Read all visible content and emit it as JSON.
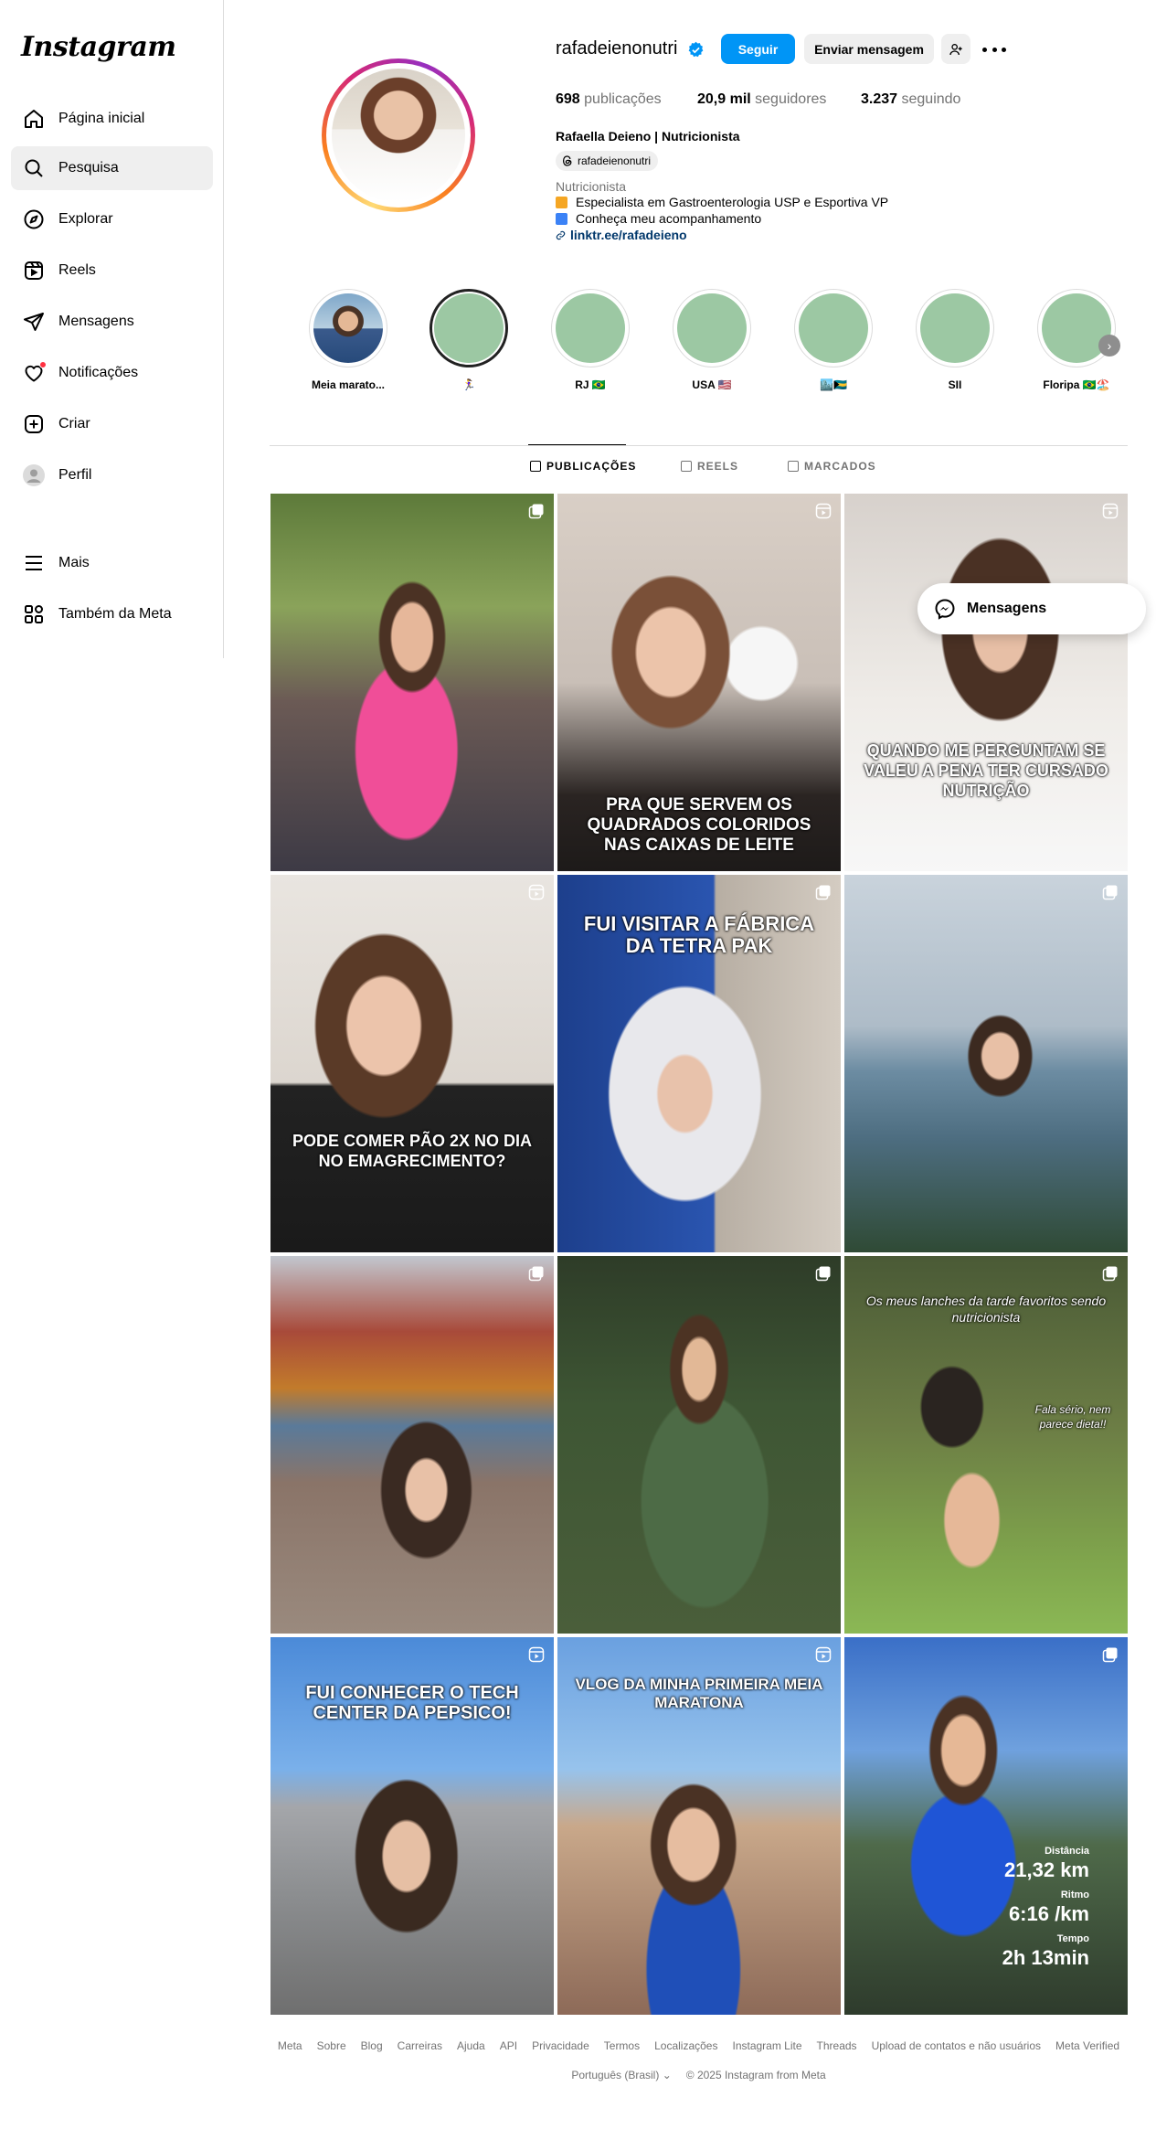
{
  "app": {
    "logo_text": "Instagram"
  },
  "sidebar": {
    "items": [
      {
        "label": "Página inicial",
        "icon": "home-icon"
      },
      {
        "label": "Pesquisa",
        "icon": "search-icon",
        "active": true
      },
      {
        "label": "Explorar",
        "icon": "compass-icon"
      },
      {
        "label": "Reels",
        "icon": "reels-icon"
      },
      {
        "label": "Mensagens",
        "icon": "direct-icon"
      },
      {
        "label": "Notificações",
        "icon": "heart-icon",
        "badge": true
      },
      {
        "label": "Criar",
        "icon": "plus-square-icon"
      },
      {
        "label": "Perfil",
        "icon": "profile-avatar"
      }
    ],
    "bottom_items": [
      {
        "label": "Mais",
        "icon": "menu-icon"
      },
      {
        "label": "Também da Meta",
        "icon": "meta-apps-icon"
      }
    ]
  },
  "profile": {
    "username": "rafadeienonutri",
    "verified": true,
    "follow_label": "Seguir",
    "message_label": "Enviar mensagem",
    "stats": {
      "posts_count": "698",
      "posts_label": "publicações",
      "followers_count": "20,9 mil",
      "followers_label": "seguidores",
      "following_count": "3.237",
      "following_label": "seguindo"
    },
    "full_name": "Rafaella Deieno | Nutricionista",
    "threads_handle": "rafadeienonutri",
    "category": "Nutricionista",
    "bio_lines": [
      "Especialista em Gastroenterologia USP e Esportiva VP",
      "Conheça meu acompanhamento"
    ],
    "link": "linktr.ee/rafadeieno"
  },
  "highlights": [
    {
      "label": "Meia marato..."
    },
    {
      "label": "🏃‍♀️"
    },
    {
      "label": "RJ 🇧🇷"
    },
    {
      "label": "USA 🇺🇸"
    },
    {
      "label": "🏙️🇧🇸"
    },
    {
      "label": "SII"
    },
    {
      "label": "Floripa 🇧🇷🏖️"
    }
  ],
  "tabs": [
    {
      "label": "PUBLICAÇÕES",
      "active": true
    },
    {
      "label": "REELS",
      "active": false
    },
    {
      "label": "MARCADOS",
      "active": false
    }
  ],
  "posts": [
    {
      "type": "carousel",
      "overlay": ""
    },
    {
      "type": "reel",
      "overlay": "PRA QUE SERVEM OS QUADRADOS COLORIDOS NAS CAIXAS DE LEITE"
    },
    {
      "type": "reel",
      "overlay": "QUANDO ME PERGUNTAM SE VALEU A PENA TER CURSADO NUTRIÇÃO"
    },
    {
      "type": "reel",
      "overlay": "PODE COMER PÃO 2X NO DIA NO EMAGRECIMENTO?"
    },
    {
      "type": "carousel",
      "overlay": "FUI VISITAR A FÁBRICA DA TETRA PAK"
    },
    {
      "type": "carousel",
      "overlay": ""
    },
    {
      "type": "carousel",
      "overlay": ""
    },
    {
      "type": "carousel",
      "overlay": ""
    },
    {
      "type": "carousel",
      "overlay": "Os meus lanches da tarde favoritos sendo nutricionista",
      "overlay2": "Fala sério, nem parece dieta!!"
    },
    {
      "type": "reel",
      "overlay": "FUI CONHECER O TECH CENTER DA PEPSICO!"
    },
    {
      "type": "reel",
      "overlay": "VLOG DA MINHA PRIMEIRA MEIA MARATONA"
    },
    {
      "type": "carousel",
      "overlay": "",
      "run_stats": {
        "distance_label": "Distância",
        "distance": "21,32 km",
        "pace_label": "Ritmo",
        "pace": "6:16 /km",
        "time_label": "Tempo",
        "time": "2h 13min"
      }
    }
  ],
  "messages_pill": {
    "label": "Mensagens"
  },
  "footer": {
    "links": [
      "Meta",
      "Sobre",
      "Blog",
      "Carreiras",
      "Ajuda",
      "API",
      "Privacidade",
      "Termos",
      "Localizações",
      "Instagram Lite",
      "Threads",
      "Upload de contatos e não usuários",
      "Meta Verified"
    ],
    "language": "Português (Brasil)",
    "copyright": "© 2025 Instagram from Meta"
  },
  "colors": {
    "accent": "#0095f6",
    "link": "#00376b",
    "muted": "#737373",
    "highlight_disc": "#9cc8a3"
  }
}
